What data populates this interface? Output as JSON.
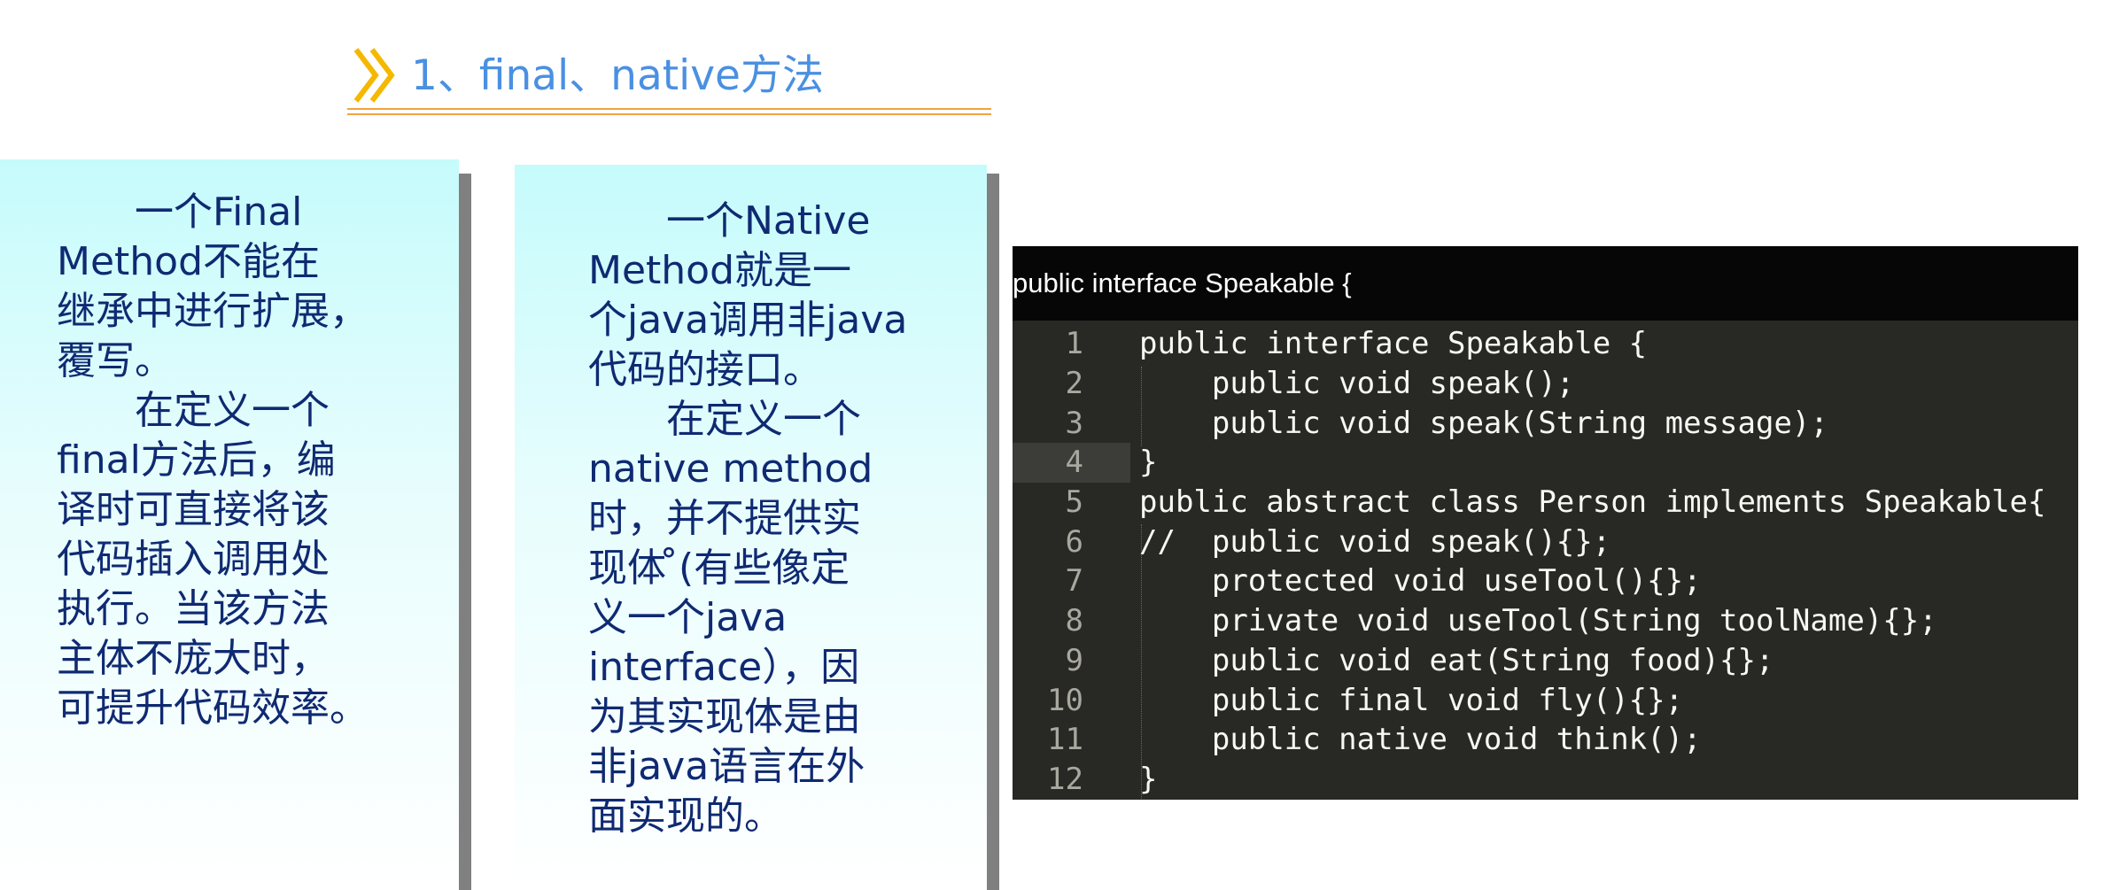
{
  "heading": {
    "text": "1、final、native方法",
    "icon": "double-chevron-right-icon",
    "icon_color": "#f5b800",
    "text_color": "#4a90e2",
    "rule_color": "#f0a441"
  },
  "final_panel": {
    "paragraphs": [
      "一个Final\nMethod不能在\n继承中进行扩展，\n覆写。",
      "在定义一个\nfinal方法后，编\n译时可直接将该\n代码插入调用处\n执行。当该方法\n主体不庞大时，\n可提升代码效率。"
    ]
  },
  "native_panel": {
    "paragraphs": [
      "一个Native\nMethod就是一\n个java调用非java\n代码的接口。",
      "在定义一个\nnative method\n时，并不提供实\n现体 ̊(有些像定\n义一个java\ninterface），因\n为其实现体是由\n非java语言在外\n面实现的。"
    ]
  },
  "code_window": {
    "title": "public interface Speakable {",
    "current_line": 4,
    "lines": [
      {
        "num": "1",
        "text": "public interface Speakable {"
      },
      {
        "num": "2",
        "text": "    public void speak();"
      },
      {
        "num": "3",
        "text": "    public void speak(String message);"
      },
      {
        "num": "4",
        "text": "}"
      },
      {
        "num": "5",
        "text": "public abstract class Person implements Speakable{"
      },
      {
        "num": "6",
        "text": "//  public void speak(){};"
      },
      {
        "num": "7",
        "text": "    protected void useTool(){};"
      },
      {
        "num": "8",
        "text": "    private void useTool(String toolName){};"
      },
      {
        "num": "9",
        "text": "    public void eat(String food){};"
      },
      {
        "num": "10",
        "text": "    public final void fly(){};"
      },
      {
        "num": "11",
        "text": "    public native void think();"
      },
      {
        "num": "12",
        "text": "}"
      }
    ]
  }
}
